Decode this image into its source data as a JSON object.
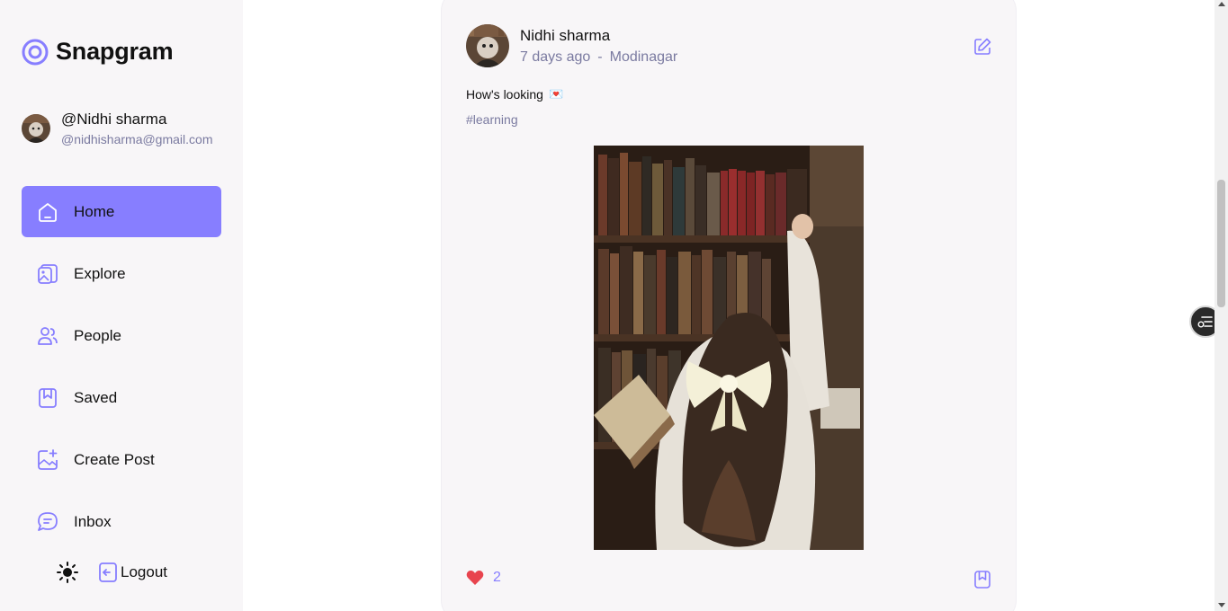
{
  "brand": {
    "name": "Snapgram",
    "accent": "#877eff"
  },
  "profile": {
    "name": "@Nidhi sharma",
    "email": "@nidhisharma@gmail.com"
  },
  "nav": [
    {
      "label": "Home",
      "icon": "home-icon",
      "active": true
    },
    {
      "label": "Explore",
      "icon": "explore-icon"
    },
    {
      "label": "People",
      "icon": "people-icon"
    },
    {
      "label": "Saved",
      "icon": "bookmark-icon"
    },
    {
      "label": "Create Post",
      "icon": "gallery-add-icon"
    },
    {
      "label": "Inbox",
      "icon": "chat-icon"
    }
  ],
  "logout_label": "Logout",
  "post": {
    "author": "Nidhi sharma",
    "time": "7 days ago",
    "separator": "-",
    "location": "Modinagar",
    "caption": "How's looking",
    "caption_emoji": "💌",
    "tags": "#learning",
    "likes": "2"
  }
}
